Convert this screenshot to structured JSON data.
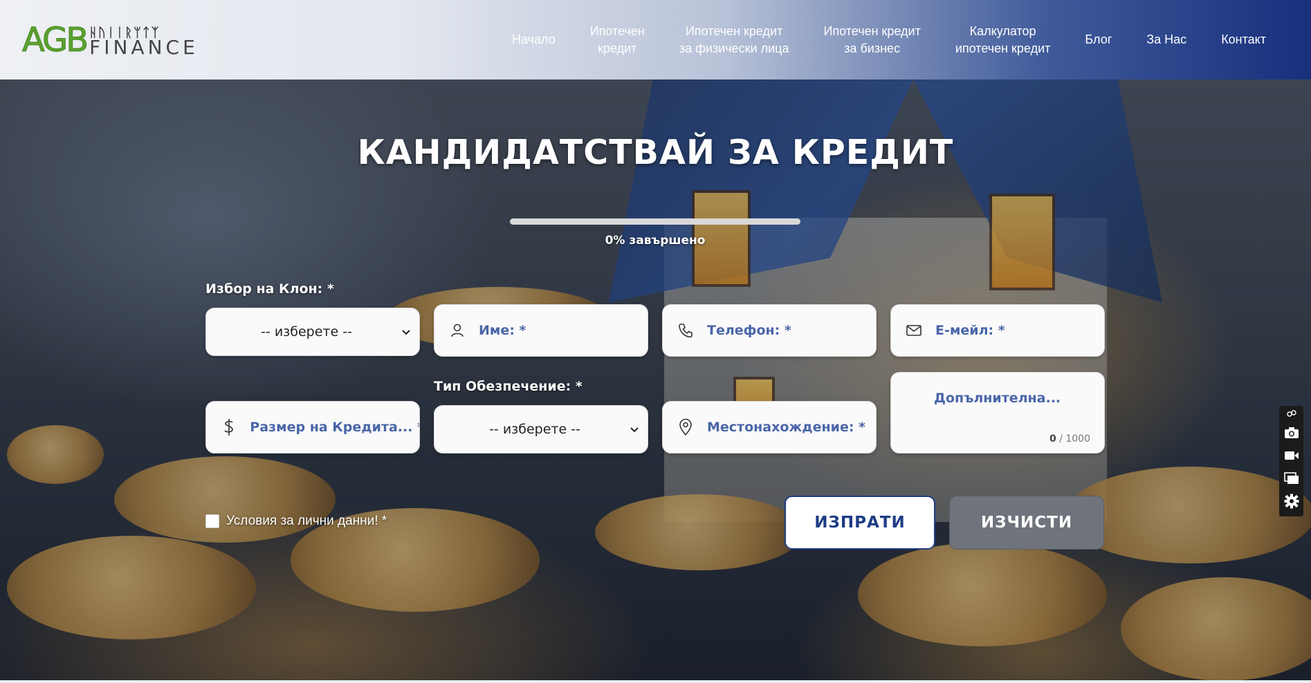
{
  "logo": {
    "primary": "AGB",
    "secondary": "FINANCE",
    "top_glyphs": "ᚺᚢᛁᛁᚱᛘᛏᛉ"
  },
  "nav": {
    "items": [
      {
        "label": "Начало"
      },
      {
        "label": "Ипотечен\nкредит"
      },
      {
        "label": "Ипотечен кредит\nза физически лица"
      },
      {
        "label": "Ипотечен кредит\nза бизнес"
      },
      {
        "label": "Калкулатор\nипотечен кредит"
      },
      {
        "label": "Блог"
      },
      {
        "label": "За Нас"
      },
      {
        "label": "Контакт"
      }
    ]
  },
  "form": {
    "title": "КАНДИДАТСТВАЙ ЗА КРЕДИТ",
    "progress": {
      "percent": 0,
      "label": "0% завършено"
    },
    "branch": {
      "label": "Избор на Клон: *",
      "value": "-- изберете --"
    },
    "name": {
      "placeholder": "Име: *",
      "icon": "user-icon"
    },
    "phone": {
      "placeholder": "Телефон: *",
      "icon": "phone-icon"
    },
    "email": {
      "placeholder": "Е-мейл: *",
      "icon": "mail-icon"
    },
    "amount": {
      "placeholder": "Размер на Кредита... *",
      "icon": "dollar-icon"
    },
    "collateral": {
      "label": "Тип Обезпечение: *",
      "value": "-- изберете --"
    },
    "location": {
      "placeholder": "Местонахождение: *",
      "icon": "location-pin-icon"
    },
    "additional": {
      "placeholder": "Допълнителна...",
      "count": "0",
      "max": "/ 1000"
    },
    "consent": {
      "label": "Условия за лични данни! *"
    },
    "submit_label": "ИЗПРАТИ",
    "clear_label": "ИЗЧИСТИ"
  },
  "colors": {
    "accent": "#1f3d85",
    "placeholder": "#4a66a8",
    "logo_green": "#5aa12e",
    "clear_button": "#6f737b"
  },
  "side_toolbar": {
    "icons": [
      "link-icon",
      "camera-icon",
      "video-icon",
      "window-icon",
      "gear-icon"
    ]
  }
}
